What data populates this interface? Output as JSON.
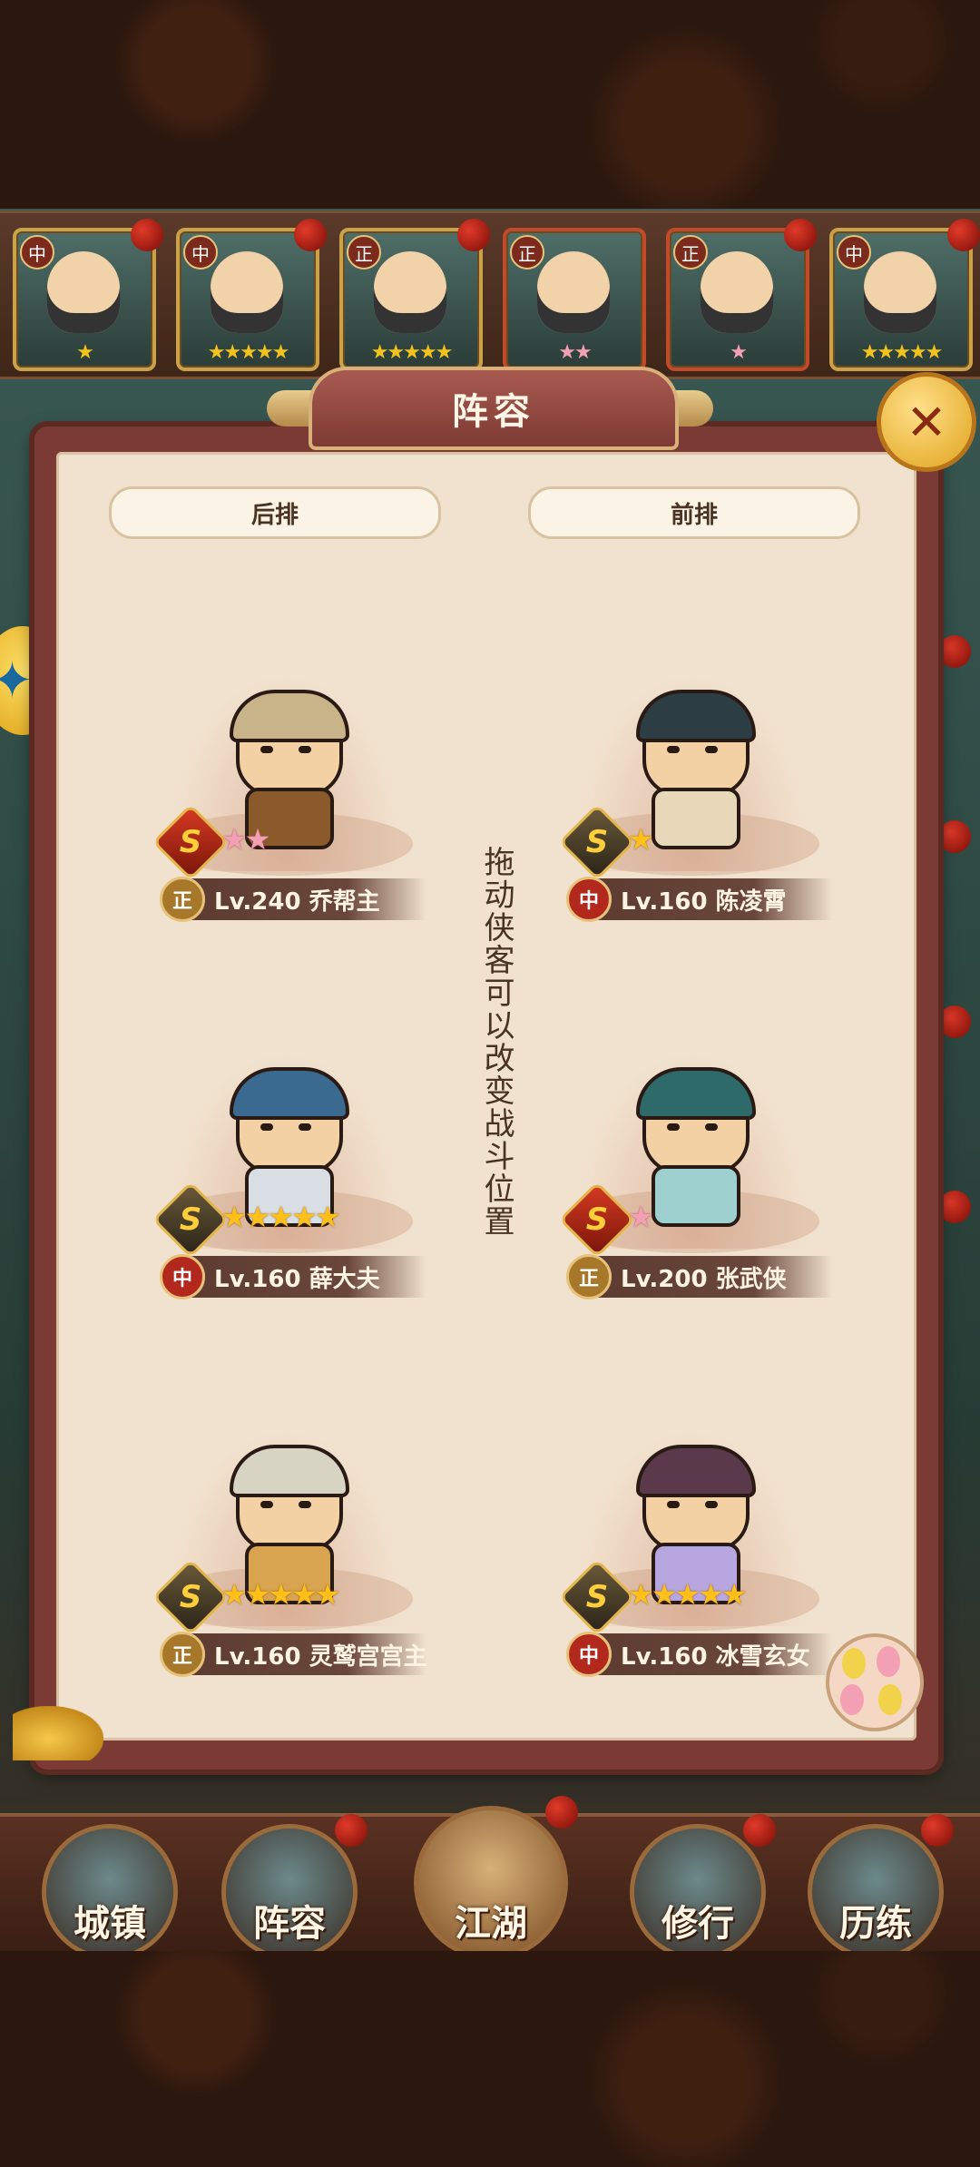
{
  "header": {
    "title": "阵容"
  },
  "roster": [
    {
      "faction": "中",
      "stars": "★",
      "color": "#c9a24a"
    },
    {
      "faction": "中",
      "stars": "★★★★★",
      "color": "#c9a24a"
    },
    {
      "faction": "正",
      "stars": "★★★★★",
      "color": "#c9a24a"
    },
    {
      "faction": "正",
      "stars": "★★",
      "color": "#c04a2a"
    },
    {
      "faction": "正",
      "stars": "★",
      "color": "#c04a2a"
    },
    {
      "faction": "中",
      "stars": "★★★★★",
      "color": "#c9a24a"
    }
  ],
  "rows": {
    "back": "后排",
    "front": "前排"
  },
  "hint": "拖动侠客可以改变战斗位置",
  "heroes": [
    {
      "name": "Lv.240 乔帮主",
      "faction": "正",
      "rank": "S",
      "rank_style": "red",
      "stars": "★★",
      "star_style": "pink"
    },
    {
      "name": "Lv.160 陈凌霄",
      "faction": "中",
      "rank": "S",
      "rank_style": "gold",
      "stars": "★",
      "star_style": "gold"
    },
    {
      "name": "Lv.160 薛大夫",
      "faction": "中",
      "rank": "S",
      "rank_style": "gold",
      "stars": "★★★★★",
      "star_style": "gold"
    },
    {
      "name": "Lv.200 张武侠",
      "faction": "正",
      "rank": "S",
      "rank_style": "red",
      "stars": "★",
      "star_style": "pink"
    },
    {
      "name": "Lv.160 灵鹫宫宫主",
      "faction": "正",
      "rank": "S",
      "rank_style": "gold",
      "stars": "★★★★★",
      "star_style": "gold"
    },
    {
      "name": "Lv.160 冰雪玄女",
      "faction": "中",
      "rank": "S",
      "rank_style": "gold",
      "stars": "★★★★★",
      "star_style": "gold"
    }
  ],
  "nav": [
    {
      "label": "城镇"
    },
    {
      "label": "阵容"
    },
    {
      "label": "江湖"
    },
    {
      "label": "修行"
    },
    {
      "label": "历练"
    }
  ],
  "close_icon": "close-icon",
  "colors": {
    "panel": "#7b3a33",
    "paper": "#f1e2cf",
    "gold": "#ffc01a",
    "pink_star": "#f4a0b4"
  }
}
